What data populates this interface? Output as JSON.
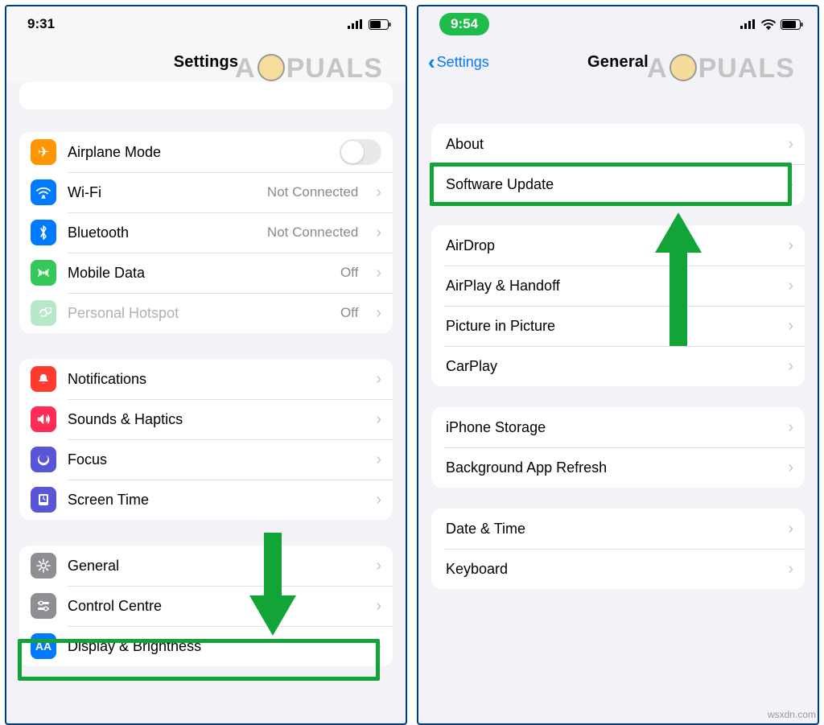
{
  "watermark": "PUALS",
  "left": {
    "time": "9:31",
    "title": "Settings",
    "groups": {
      "network": {
        "airplane": "Airplane Mode",
        "wifi": "Wi-Fi",
        "wifi_value": "Not Connected",
        "bluetooth": "Bluetooth",
        "bluetooth_value": "Not Connected",
        "mobiledata": "Mobile Data",
        "mobiledata_value": "Off",
        "hotspot": "Personal Hotspot",
        "hotspot_value": "Off"
      },
      "attention": {
        "notifications": "Notifications",
        "sounds": "Sounds & Haptics",
        "focus": "Focus",
        "screentime": "Screen Time"
      },
      "system": {
        "general": "General",
        "control": "Control Centre",
        "display": "Display & Brightness"
      }
    }
  },
  "right": {
    "time": "9:54",
    "back": "Settings",
    "title": "General",
    "groups": {
      "top": {
        "about": "About",
        "software": "Software Update"
      },
      "sharing": {
        "airdrop": "AirDrop",
        "airplay": "AirPlay & Handoff",
        "pip": "Picture in Picture",
        "carplay": "CarPlay"
      },
      "storage": {
        "iphonestorage": "iPhone Storage",
        "backgroundrefresh": "Background App Refresh"
      },
      "datetime": {
        "datetime": "Date & Time",
        "keyboard": "Keyboard"
      }
    }
  },
  "footer": "wsxdn.com"
}
